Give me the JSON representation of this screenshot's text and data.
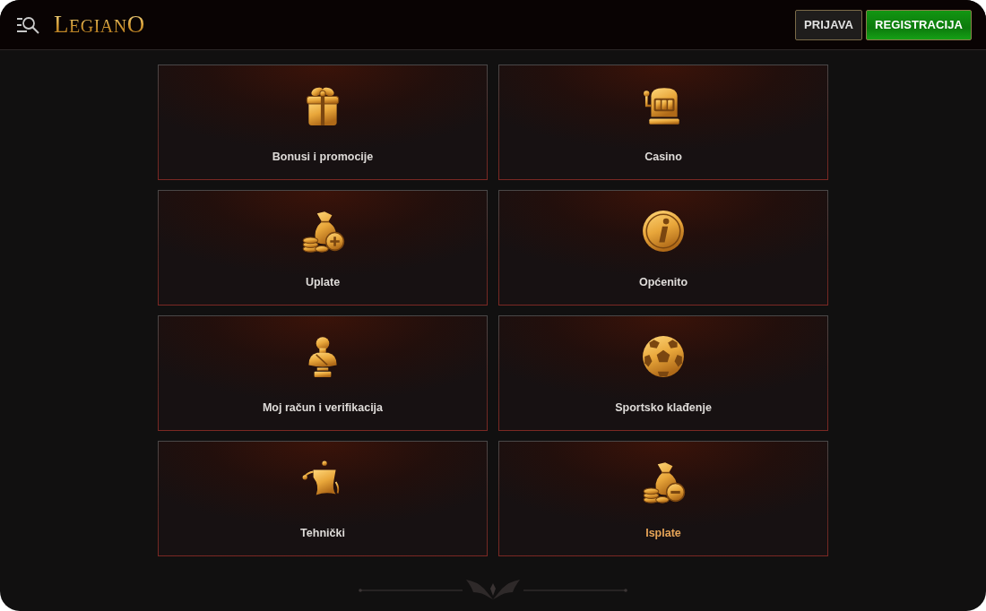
{
  "header": {
    "logo": "LEGIANO",
    "buttons": [
      {
        "label": "PRIJAVA",
        "kind": "login"
      },
      {
        "label": "REGISTRACIJA",
        "kind": "register"
      }
    ]
  },
  "categories": [
    {
      "label": "Bonusi i promocije",
      "selected": false
    },
    {
      "label": "Casino",
      "selected": false
    },
    {
      "label": "Uplate",
      "selected": false
    },
    {
      "label": "Općenito",
      "selected": false
    },
    {
      "label": "Moj račun i verifikacija",
      "selected": false
    },
    {
      "label": "Sportsko klađenje",
      "selected": false
    },
    {
      "label": "Tehnički",
      "selected": false
    },
    {
      "label": "Isplate",
      "selected": true
    }
  ]
}
